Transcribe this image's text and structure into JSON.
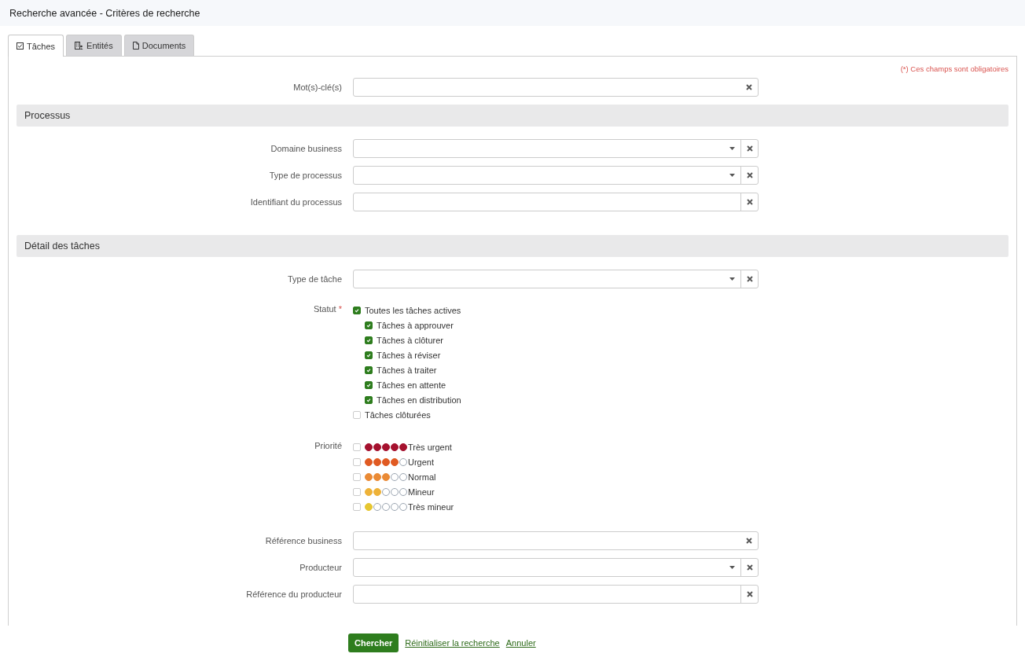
{
  "window": {
    "title": "Recherche avancée - Critères de recherche"
  },
  "tabs": [
    {
      "label": "Tâches",
      "kind": "checkbox",
      "selected": true
    },
    {
      "label": "Entités",
      "kind": "building",
      "selected": false
    },
    {
      "label": "Documents",
      "kind": "document",
      "selected": false
    }
  ],
  "required_note": "(*) Ces champs sont obligatoires",
  "form": [
    {
      "kind": "text",
      "label": "Mot(s)-clé(s)"
    },
    {
      "kind": "section",
      "title": "Processus"
    },
    {
      "kind": "select",
      "label": "Domaine business"
    },
    {
      "kind": "select",
      "label": "Type de processus"
    },
    {
      "kind": "addon",
      "label": "Identifiant du processus"
    },
    {
      "kind": "section",
      "title": "Détail des tâches"
    },
    {
      "kind": "select",
      "label": "Type de tâche"
    },
    {
      "kind": "checkboxes",
      "label": "Statut",
      "required_mark": "*",
      "items": [
        {
          "label": "Toutes les tâches actives",
          "checked": true,
          "children": [
            {
              "label": "Tâches à approuver",
              "checked": true
            },
            {
              "label": "Tâches à clôturer",
              "checked": true
            },
            {
              "label": "Tâches à réviser",
              "checked": true
            },
            {
              "label": "Tâches à traiter",
              "checked": true
            },
            {
              "label": "Tâches en attente",
              "checked": true
            },
            {
              "label": "Tâches en distribution",
              "checked": true
            }
          ]
        },
        {
          "label": "Tâches clôturées",
          "checked": false
        }
      ]
    },
    {
      "kind": "priority",
      "label": "Priorité",
      "items": [
        {
          "label": "Très urgent",
          "checked": false,
          "stars": 5,
          "color": "#a5112e"
        },
        {
          "label": "Urgent",
          "checked": false,
          "stars": 4,
          "color": "#e05a22"
        },
        {
          "label": "Normal",
          "checked": false,
          "stars": 3,
          "color": "#ea8a35"
        },
        {
          "label": "Mineur",
          "checked": false,
          "stars": 2,
          "color": "#eeb238"
        },
        {
          "label": "Très mineur",
          "checked": false,
          "stars": 1,
          "color": "#e6c630"
        }
      ]
    },
    {
      "kind": "text",
      "label": "Référence business"
    },
    {
      "kind": "select",
      "label": "Producteur"
    },
    {
      "kind": "addon",
      "label": "Référence du producteur"
    }
  ],
  "actions": {
    "submit": "Chercher",
    "links": [
      "Réinitialiser la recherche",
      "Annuler"
    ]
  }
}
